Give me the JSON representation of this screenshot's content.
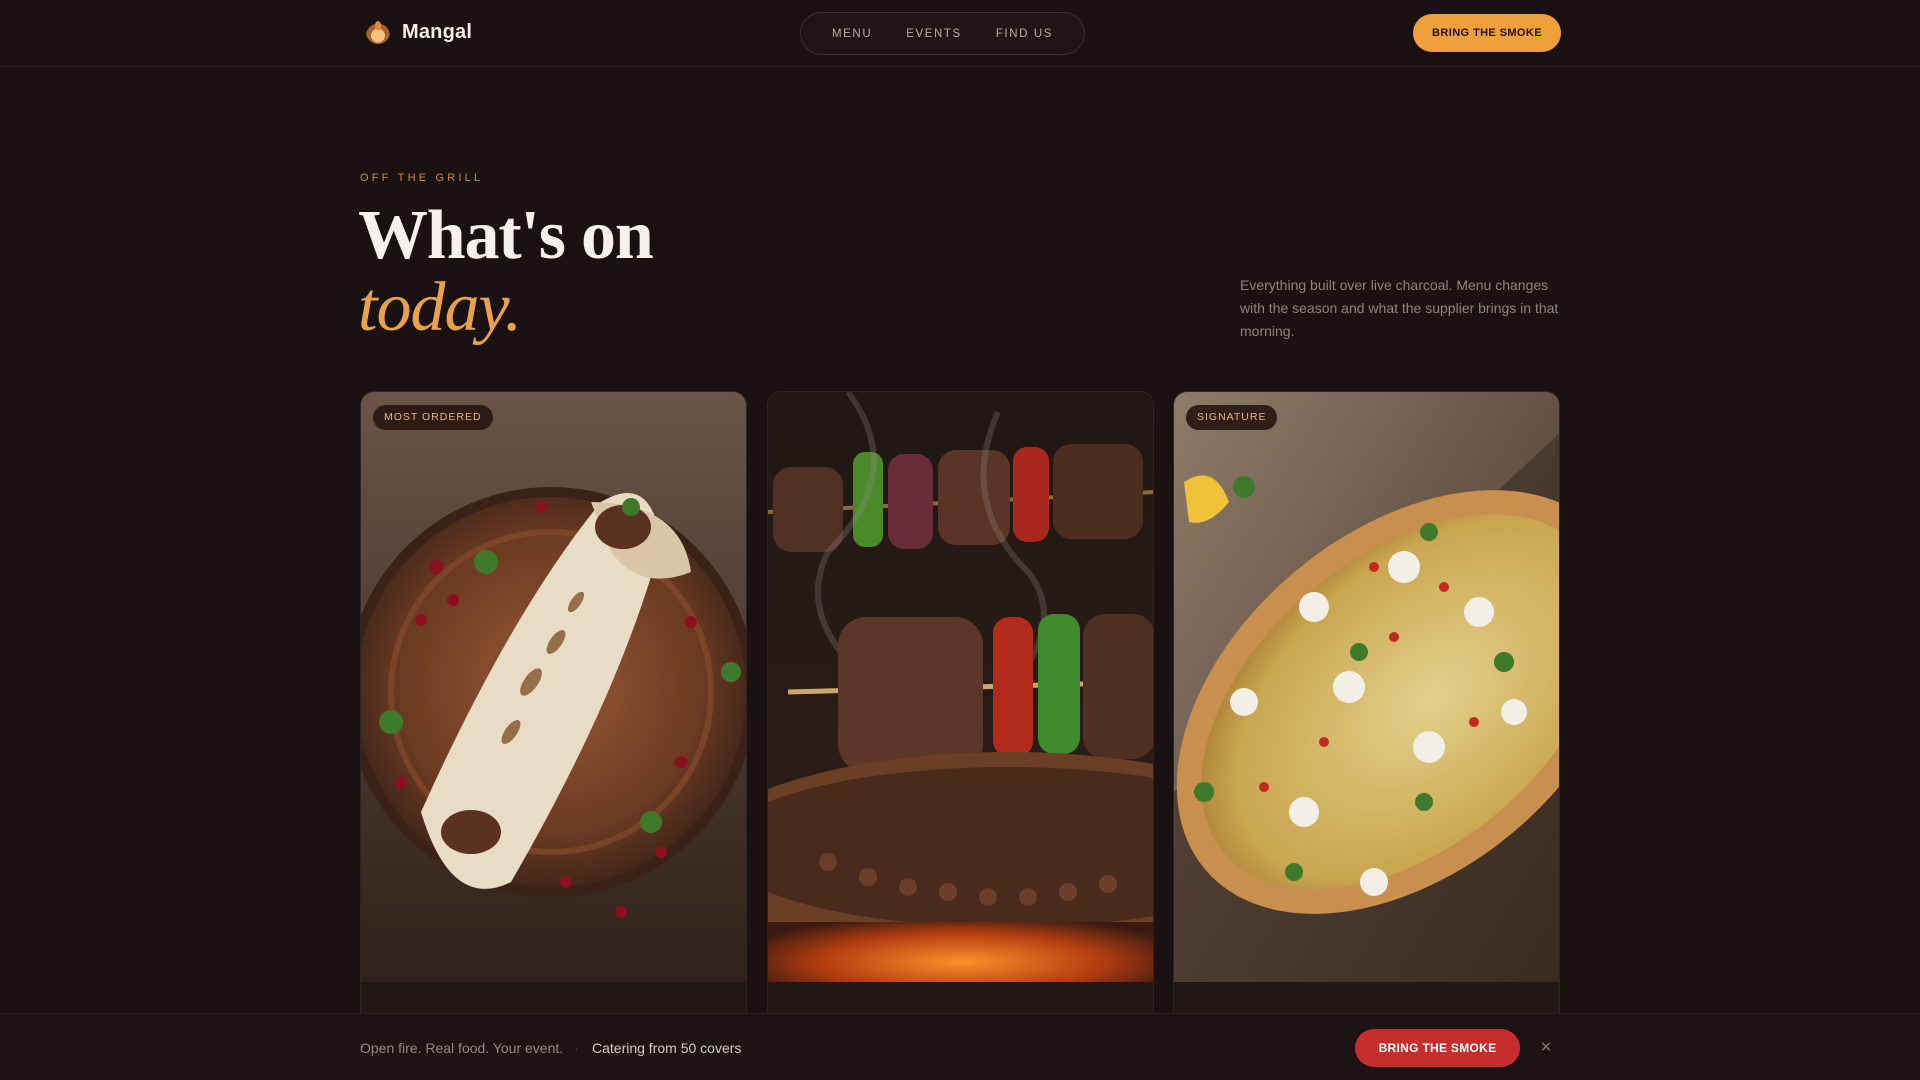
{
  "brand": {
    "name": "Mangal",
    "logo_icon": "flame-logo-icon"
  },
  "nav": {
    "items": [
      "MENU",
      "EVENTS",
      "FIND US"
    ]
  },
  "header_cta": "BRING THE SMOKE",
  "hero": {
    "eyebrow": "OFF THE GRILL",
    "title_line1": "What's on",
    "title_line2": "today.",
    "intro": "Everything built over live charcoal. Menu changes with the season and what the supplier brings in that morning."
  },
  "cards": [
    {
      "badge": "MOST ORDERED",
      "image": "grilled-wrap-photo"
    },
    {
      "badge": "",
      "image": "kebab-skewers-photo"
    },
    {
      "badge": "SIGNATURE",
      "image": "flatbread-pide-photo"
    }
  ],
  "bottom_bar": {
    "tagline": "Open fire. Real food. Your event.",
    "separator": "·",
    "catering": "Catering from 50 covers",
    "cta": "BRING THE SMOKE",
    "close_icon": "close-icon"
  },
  "colors": {
    "background": "#1a1212",
    "accent_orange": "#f0a03a",
    "accent_red": "#c72d2d",
    "italic_accent": "#e9a14b"
  }
}
